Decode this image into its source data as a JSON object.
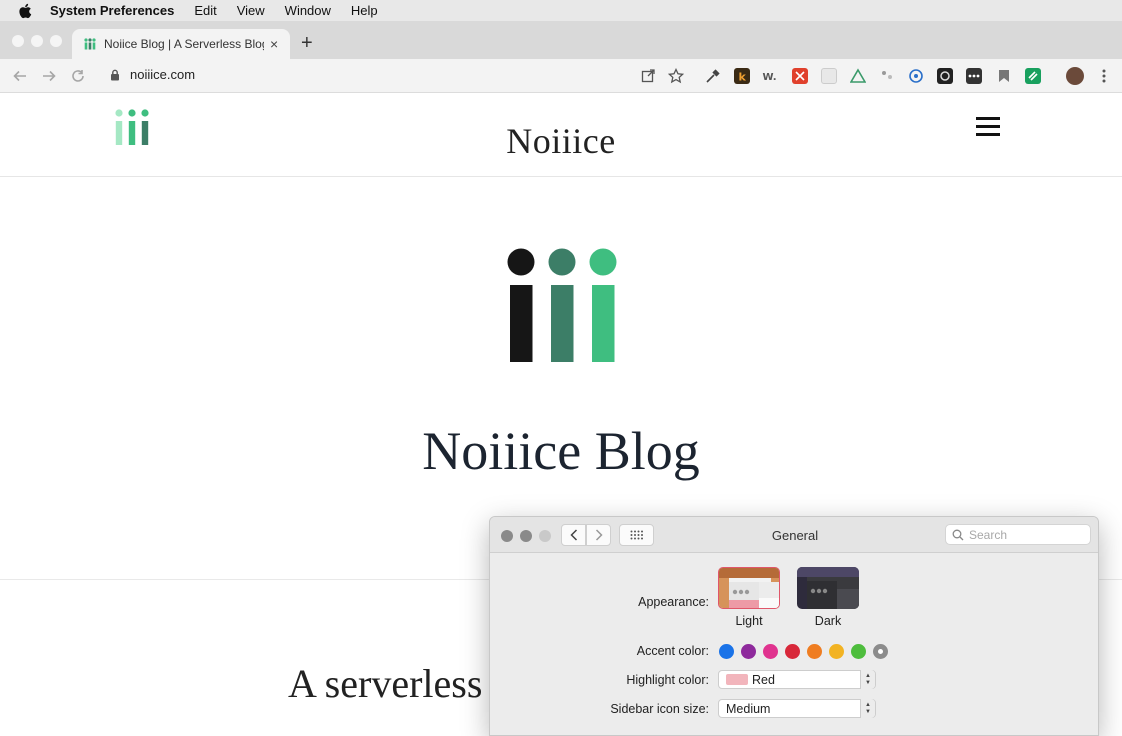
{
  "menubar": {
    "app_name": "System Preferences",
    "items": [
      "Edit",
      "View",
      "Window",
      "Help"
    ]
  },
  "browser": {
    "tab_title": "Noiice Blog | A Serverless Blog",
    "new_tab_label": "+",
    "close_label": "×",
    "url": "noiiice.com"
  },
  "site": {
    "header_title": "Noiiice",
    "hero_title": "Noiiice Blog",
    "tagline": "A serverless b",
    "logo_colors": [
      "#161616",
      "#3c7e67",
      "#3fbe80"
    ]
  },
  "prefs": {
    "title": "General",
    "search_placeholder": "Search",
    "appearance_label": "Appearance:",
    "appearance_options": [
      {
        "label": "Light",
        "selected": true
      },
      {
        "label": "Dark",
        "selected": false
      }
    ],
    "accent_label": "Accent color:",
    "accent_colors": [
      "#1a73e8",
      "#8e2a9c",
      "#e0338f",
      "#d8283a",
      "#ef7d21",
      "#f2b323",
      "#4ebd3d",
      "#8c8c8c"
    ],
    "highlight_label": "Highlight color:",
    "highlight_value": "Red",
    "sidebar_label": "Sidebar icon size:",
    "sidebar_value": "Medium"
  }
}
